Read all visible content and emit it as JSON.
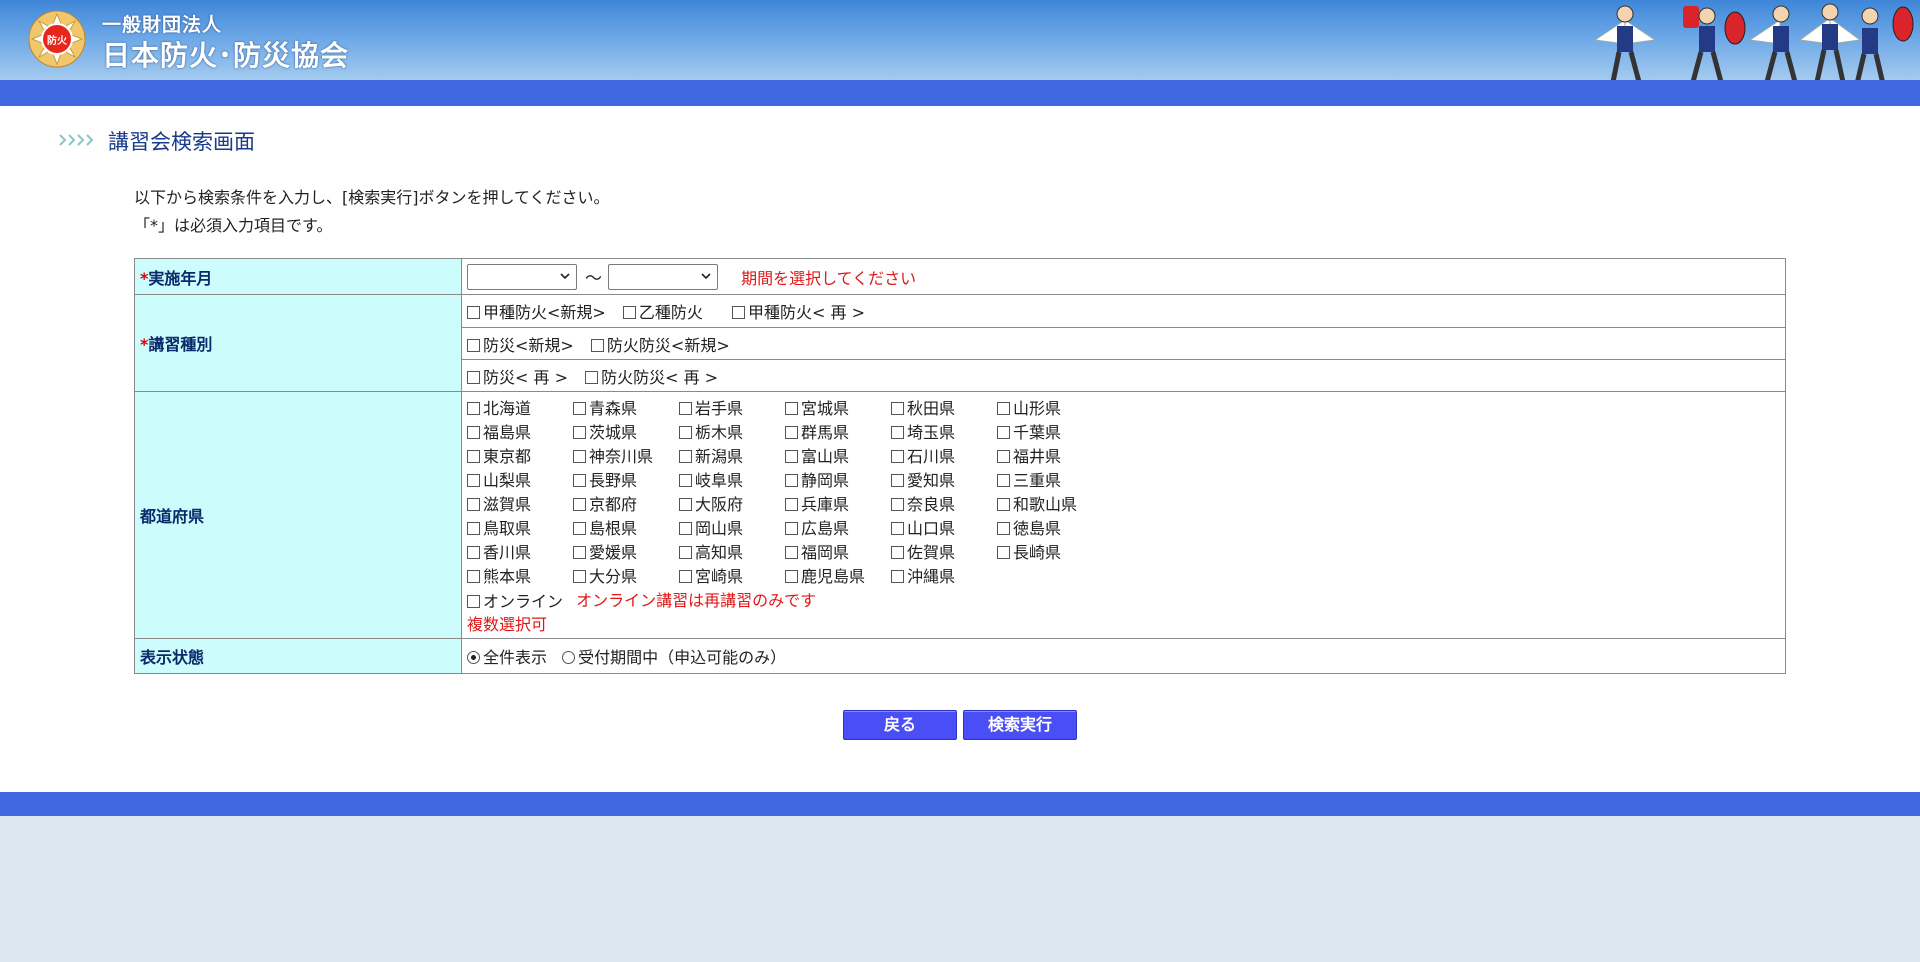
{
  "header": {
    "logo_text": "防火",
    "org_small": "一般財団法人",
    "org_big": "日本防火･防災協会"
  },
  "page": {
    "title": "講習会検索画面",
    "intro_line1": "以下から検索条件を入力し、[検索実行]ボタンを押してください。",
    "intro_line2": "「*」は必須入力項目です。"
  },
  "form": {
    "date": {
      "required_mark": "*",
      "label": "実施年月",
      "from_value": "",
      "to_value": "",
      "separator": "～",
      "warning": "期間を選択してください"
    },
    "course": {
      "required_mark": "*",
      "label": "講習種別",
      "row1": [
        "甲種防火<新規>",
        "乙種防火",
        "甲種防火< 再 >"
      ],
      "row2": [
        "防災<新規>",
        "防火防災<新規>"
      ],
      "row3": [
        "防災< 再 >",
        "防火防災< 再 >"
      ]
    },
    "prefecture": {
      "label": "都道府県",
      "items": [
        "北海道",
        "青森県",
        "岩手県",
        "宮城県",
        "秋田県",
        "山形県",
        "福島県",
        "茨城県",
        "栃木県",
        "群馬県",
        "埼玉県",
        "千葉県",
        "東京都",
        "神奈川県",
        "新潟県",
        "富山県",
        "石川県",
        "福井県",
        "山梨県",
        "長野県",
        "岐阜県",
        "静岡県",
        "愛知県",
        "三重県",
        "滋賀県",
        "京都府",
        "大阪府",
        "兵庫県",
        "奈良県",
        "和歌山県",
        "鳥取県",
        "島根県",
        "岡山県",
        "広島県",
        "山口県",
        "徳島県",
        "香川県",
        "愛媛県",
        "高知県",
        "福岡県",
        "佐賀県",
        "長崎県",
        "熊本県",
        "大分県",
        "宮崎県",
        "鹿児島県",
        "沖縄県"
      ],
      "online_label": "オンライン",
      "online_note": "オンライン講習は再講習のみです",
      "multi_note": "複数選択可"
    },
    "status": {
      "label": "表示状態",
      "opt_all": "全件表示",
      "opt_open": "受付期間中（申込可能のみ）",
      "selected": "全件表示"
    }
  },
  "buttons": {
    "back": "戻る",
    "search": "検索実行"
  },
  "colors": {
    "header_bar": "#3f67e0",
    "label_bg": "#ccfcfc",
    "button": "#4a4ef5",
    "warning": "#e01818"
  }
}
